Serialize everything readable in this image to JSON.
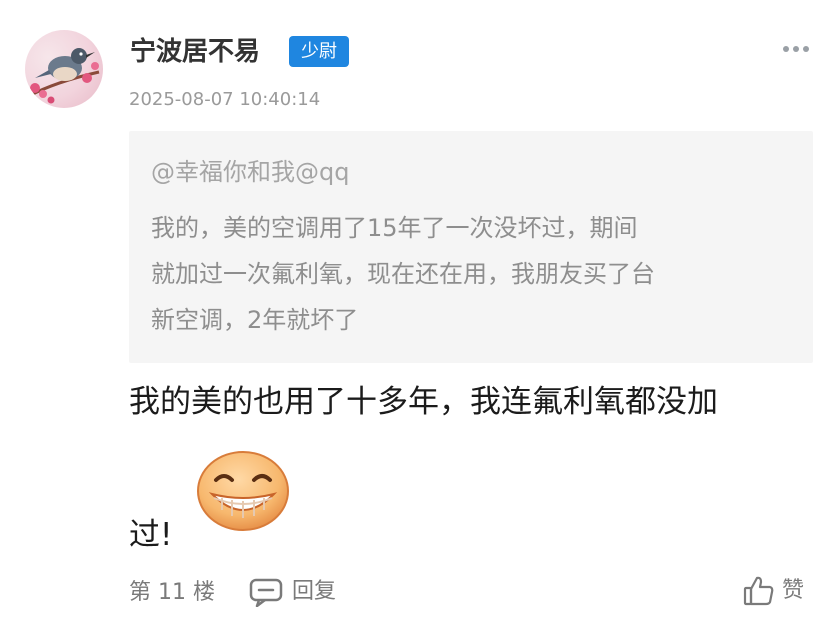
{
  "post": {
    "username": "宁波居不易",
    "rank_badge": "少尉",
    "timestamp": "2025-08-07 10:40:14",
    "quote": {
      "user": "@幸福你和我@qq",
      "lines": [
        "我的，美的空调用了15年了一次没坏过，期间",
        "就加过一次氟利氧，现在还在用，我朋友买了台",
        "新空调，2年就坏了"
      ]
    },
    "reply": {
      "line1": "我的美的也用了十多年，我连氟利氧都没加",
      "line2": "过!"
    },
    "emoji": "grinning-face-icon",
    "footer": {
      "floor": "第 11 楼",
      "reply_label": "回复",
      "like_label": "赞"
    }
  },
  "colors": {
    "badge_bg": "#1f86e0",
    "quote_bg": "#f5f5f5",
    "muted_text": "#9a9a9a"
  }
}
